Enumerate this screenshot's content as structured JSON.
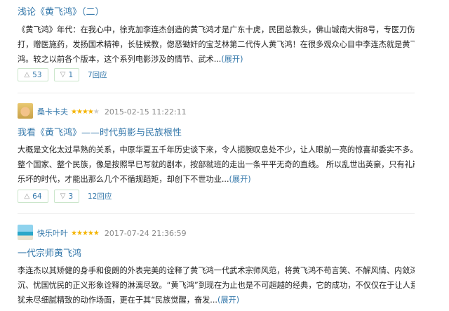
{
  "reviews": [
    {
      "title": "浅论《黄飞鸿》（二）",
      "body": [
        "《黄飞鸿》年代：在我心中，徐克加李连杰创造的黄飞鸿才是广东十虎，民团总教头，佛山城南大街8号，专医刀伤跌",
        "打，赠医施药，发扬国术精神，长驻候教，偬恶锄奸的宝芝林第二代传人黄飞鸿！在很多观众心目中李连杰就是黄飞",
        "鸿。较之以前各个版本，这个系列电影涉及的情节、武术..."
      ],
      "expand": "(展开)",
      "up_count": "53",
      "down_count": "1",
      "replies": "7回应"
    },
    {
      "author": "桑卡卡夫",
      "rating": 4,
      "date": "2015-02-15 11:22:11",
      "title": "我看《黄飞鸿》——时代剪影与民族根性",
      "body": [
        "大概是文化太过早熟的关系，中原华夏五千年历史谈下来，令人扼腕叹息处不少，让人眼前一亮的惊喜却委实不多。",
        "整个国家、整个民族，像是按照早已写就的剧本，按部就班的走出一条平平无奇的直线。 所以乱世出英豪，只有礼崩",
        "乐坏的时代，才能出那么几个不循规蹈矩，却创下不世功业..."
      ],
      "expand": "(展开)",
      "up_count": "64",
      "down_count": "3",
      "replies": "12回应"
    },
    {
      "author": "快乐叶叶",
      "rating": 5,
      "date": "2017-07-24 21:36:59",
      "title": "一代宗师黄飞鸿",
      "body": [
        "李连杰以其矫健的身手和俊朗的外表完美的诠释了黄飞鸿一代武术宗师风范，将黄飞鸿不苟言笑、不解风情、内敛深",
        "沉、忧国忧民的正义形象诠释的淋漓尽致。“黄飞鸿”到现在为止也是不可超越的经典，它的成功，不仅仅在于让人意",
        "犹未尽细腻精致的动作场面，更在于其“民族觉醒，奋发..."
      ],
      "expand": "(展开)"
    }
  ],
  "icons": {
    "up": "triangle-up-icon",
    "down": "triangle-down-icon",
    "star": "star-icon"
  },
  "colors": {
    "link": "#3377aa",
    "star": "#f4b400",
    "meta": "#888888"
  }
}
